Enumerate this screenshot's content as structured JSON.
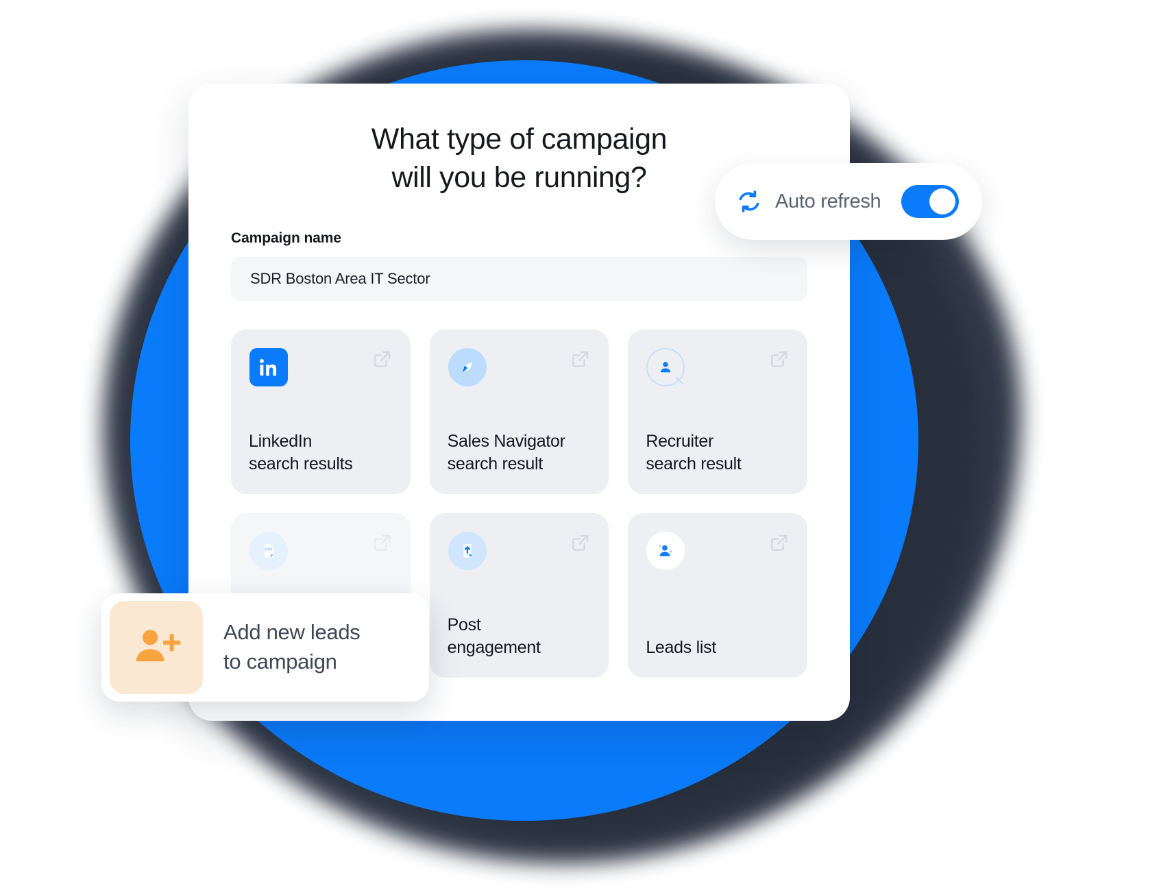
{
  "headline": "What type of campaign\nwill you be running?",
  "form": {
    "label": "Campaign name",
    "value": "SDR Boston Area IT Sector",
    "placeholder": "Campaign name"
  },
  "auto_refresh": {
    "label": "Auto refresh",
    "icon": "refresh-icon",
    "enabled": "on"
  },
  "cards": [
    {
      "label": "LinkedIn\nsearch results",
      "icon": "linkedin-icon",
      "ext": "external-link-icon"
    },
    {
      "label": "Sales Navigator\nsearch result",
      "icon": "compass-icon",
      "ext": "external-link-icon"
    },
    {
      "label": "Recruiter\nsearch result",
      "icon": "person-search-icon",
      "ext": "external-link-icon"
    },
    {
      "label": "",
      "icon": "csv-file-icon",
      "ext": "external-link-icon"
    },
    {
      "label": "Post\nengagement",
      "icon": "document-upload-icon",
      "ext": "external-link-icon"
    },
    {
      "label": "Leads list",
      "icon": "person-sparkle-icon",
      "ext": "external-link-icon"
    }
  ],
  "add_leads": {
    "text": "Add new leads\nto campaign",
    "icon": "person-add-icon"
  },
  "colors": {
    "brand_blue": "#0a7bfb",
    "dark_blob": "#2b3443",
    "card_bg": "#edeff3",
    "accent_orange": "#f7a440",
    "accent_peach": "#fae8d2"
  }
}
